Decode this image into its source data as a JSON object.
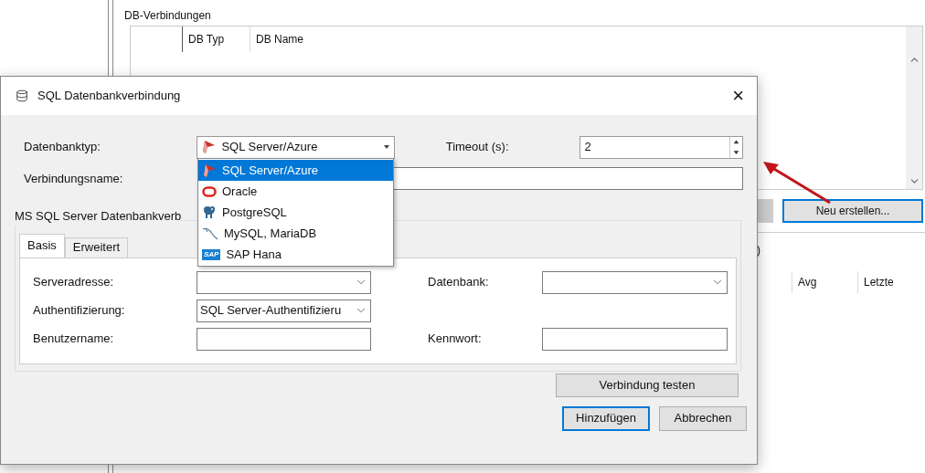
{
  "background": {
    "group_title": "DB-Verbindungen",
    "table_columns": [
      "DB Typ",
      "DB Name"
    ],
    "new_button": "Neu erstellen...",
    "partial_text": ")",
    "stats_columns": [
      "Avg",
      "Letzte"
    ]
  },
  "dialog": {
    "title": "SQL Datenbankverbindung",
    "close": "×",
    "db_type_label": "Datenbanktyp:",
    "db_type_value": "SQL Server/Azure",
    "timeout_label": "Timeout (s):",
    "timeout_value": "2",
    "name_label": "Verbindungsname:",
    "group_title": "MS SQL Server Datenbankverb",
    "tabs": [
      {
        "label": "Basis",
        "selected": true
      },
      {
        "label": "Erweitert",
        "selected": false
      }
    ],
    "fields": [
      {
        "label": "Serveradresse:",
        "kind": "combo"
      },
      {
        "label": "Datenbank:",
        "kind": "combo"
      },
      {
        "label": "Authentifizierung:",
        "kind": "combo",
        "value": "SQL Server-Authentifizieru"
      },
      {
        "label": "Benutzername:",
        "kind": "text"
      },
      {
        "label": "Kennwort:",
        "kind": "text"
      }
    ],
    "test_button": "Verbindung testen",
    "buttons": [
      {
        "label": "Hinzufügen",
        "focused": true
      },
      {
        "label": "Abbrechen",
        "focused": false
      }
    ],
    "dropdown": [
      {
        "label": "SQL Server/Azure",
        "kind": "sqlserver",
        "selected": true
      },
      {
        "label": "Oracle",
        "kind": "oracle",
        "selected": false
      },
      {
        "label": "PostgreSQL",
        "kind": "postgres",
        "selected": false
      },
      {
        "label": "MySQL, MariaDB",
        "kind": "mysql",
        "selected": false
      },
      {
        "label": "SAP Hana",
        "kind": "sap",
        "logo_text": "SAP",
        "selected": false
      }
    ]
  }
}
